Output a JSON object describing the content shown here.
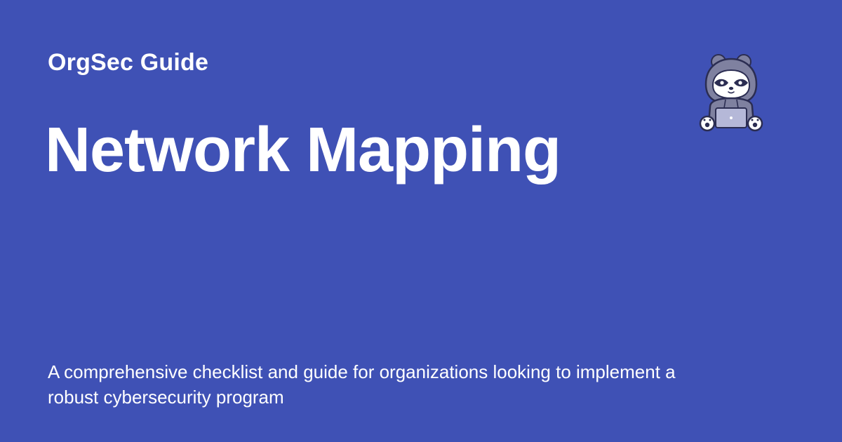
{
  "brand": {
    "site_name": "OrgSec Guide",
    "background_color": "#3f51b5"
  },
  "page": {
    "title": "Network Mapping",
    "description": "A comprehensive checklist and guide for organizations looking to implement a robust cybersecurity program"
  },
  "mascot": {
    "icon": "hooded-raccoon-laptop-icon"
  }
}
